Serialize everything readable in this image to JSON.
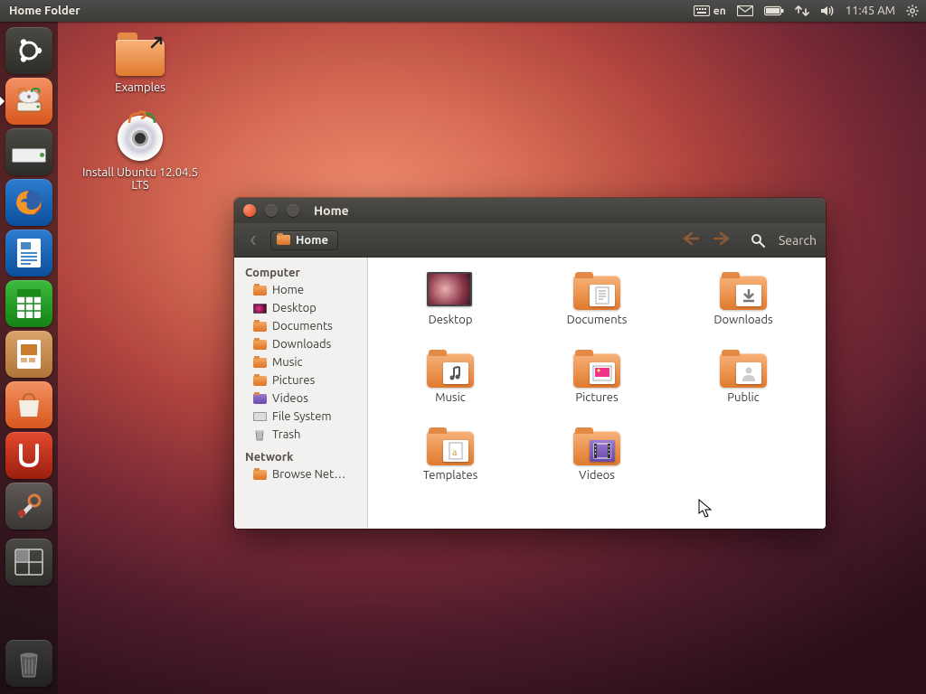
{
  "top_panel": {
    "title": "Home Folder",
    "keyboard_lang": "en",
    "time": "11:45 AM"
  },
  "launcher": [
    {
      "name": "dash",
      "bg": "bg-dark"
    },
    {
      "name": "nautilus",
      "bg": "bg-orange",
      "active": true
    },
    {
      "name": "install",
      "bg": "bg-dark"
    },
    {
      "name": "firefox",
      "bg": "bg-blue"
    },
    {
      "name": "writer",
      "bg": "bg-blue"
    },
    {
      "name": "calc",
      "bg": "bg-green"
    },
    {
      "name": "impress",
      "bg": "bg-tan"
    },
    {
      "name": "software-center",
      "bg": "bg-orange"
    },
    {
      "name": "ubuntu-one",
      "bg": "bg-red"
    },
    {
      "name": "settings",
      "bg": "bg-grey"
    },
    {
      "name": "workspace",
      "bg": "bg-dark"
    }
  ],
  "desktop": {
    "examples": "Examples",
    "install": "Install Ubuntu 12.04.5 LTS"
  },
  "window": {
    "title": "Home",
    "path_label": "Home",
    "search": "Search",
    "sidebar": {
      "section1": "Computer",
      "items1": [
        "Home",
        "Desktop",
        "Documents",
        "Downloads",
        "Music",
        "Pictures",
        "Videos",
        "File System",
        "Trash"
      ],
      "section2": "Network",
      "items2": [
        "Browse Net…"
      ]
    },
    "content": [
      {
        "label": "Desktop",
        "kind": "desktop"
      },
      {
        "label": "Documents",
        "kind": "doc"
      },
      {
        "label": "Downloads",
        "kind": "download"
      },
      {
        "label": "Music",
        "kind": "music"
      },
      {
        "label": "Pictures",
        "kind": "pictures"
      },
      {
        "label": "Public",
        "kind": "public"
      },
      {
        "label": "Templates",
        "kind": "templates"
      },
      {
        "label": "Videos",
        "kind": "videos"
      }
    ]
  }
}
